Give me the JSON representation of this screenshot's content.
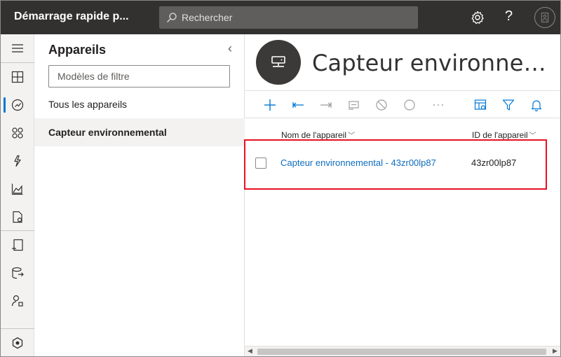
{
  "header": {
    "app_title": "Démarrage rapide p...",
    "search_placeholder": "Rechercher",
    "help_label": "?"
  },
  "panel": {
    "title": "Appareils",
    "filter_placeholder": "Modèles de filtre",
    "items": [
      {
        "label": "Tous les appareils"
      },
      {
        "label": "Capteur environnemental"
      }
    ]
  },
  "device": {
    "title": "Capteur environne…"
  },
  "table": {
    "columns": [
      {
        "label": "Nom de l'appareil"
      },
      {
        "label": "ID de l'appareil"
      }
    ],
    "rows": [
      {
        "name": "Capteur environnemental - 43zr00lp87",
        "id": "43zr00lp87"
      }
    ]
  },
  "colors": {
    "topbar": "#323130",
    "accent": "#0078d4",
    "link": "#0f6cbd",
    "highlight": "#e81123"
  }
}
